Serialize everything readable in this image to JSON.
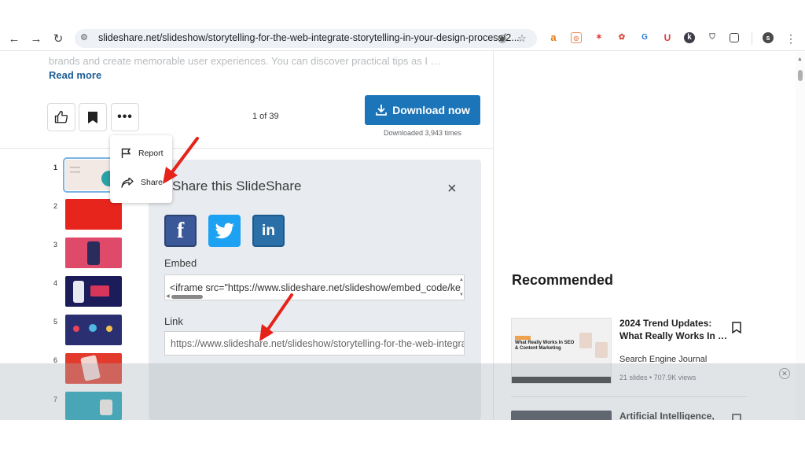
{
  "browser": {
    "url": "slideshare.net/slideshow/storytelling-for-the-web-integrate-storytelling-in-your-design-process/2...",
    "profile_initial": "s"
  },
  "page": {
    "description_faded": "brands and create memorable user experiences. You can discover practical tips as I …",
    "read_more": "Read more",
    "page_count": "1 of 39",
    "download_label": "Download now",
    "downloaded_text": "Downloaded 3,943 times"
  },
  "popup_menu": {
    "items": [
      {
        "label": "Report",
        "icon": "flag-icon"
      },
      {
        "label": "Share",
        "icon": "share-icon"
      }
    ]
  },
  "thumbnails": [
    {
      "number": "1",
      "color": "#f3e9e4"
    },
    {
      "number": "2",
      "color": "#e8251d"
    },
    {
      "number": "3",
      "color": "#df4a6b"
    },
    {
      "number": "4",
      "color": "#1c1c5a"
    },
    {
      "number": "5",
      "color": "#2a2f72"
    },
    {
      "number": "6",
      "color": "#e33b2b"
    },
    {
      "number": "7",
      "color": "#14a0b5"
    }
  ],
  "share_panel": {
    "title": "Share this SlideShare",
    "close": "×",
    "embed_label": "Embed",
    "embed_code": "<iframe src=\"https://www.slideshare.net/slideshow/embed_code/ke",
    "link_label": "Link",
    "link_url": "https://www.slideshare.net/slideshow/storytelling-for-the-web-integra",
    "social": [
      {
        "name": "facebook",
        "color": "#3b5998",
        "glyph": "f"
      },
      {
        "name": "twitter",
        "color": "#1da1f2",
        "glyph": "t"
      },
      {
        "name": "linkedin",
        "color": "#0a66c2",
        "glyph": "in"
      }
    ]
  },
  "recommended": {
    "heading": "Recommended",
    "items": [
      {
        "title_line1": "2024 Trend Updates:",
        "title_line2": "What Really Works In …",
        "author": "Search Engine Journal",
        "meta": "21 slides  •  707.9K views",
        "thumb_heading": "What Really Works In SEO & Content Marketing"
      },
      {
        "title_line1": "Artificial Intelligence,"
      }
    ]
  },
  "colors": {
    "accent": "#1b75b8",
    "link": "#1b5e95",
    "arrow": "#e5231b"
  }
}
